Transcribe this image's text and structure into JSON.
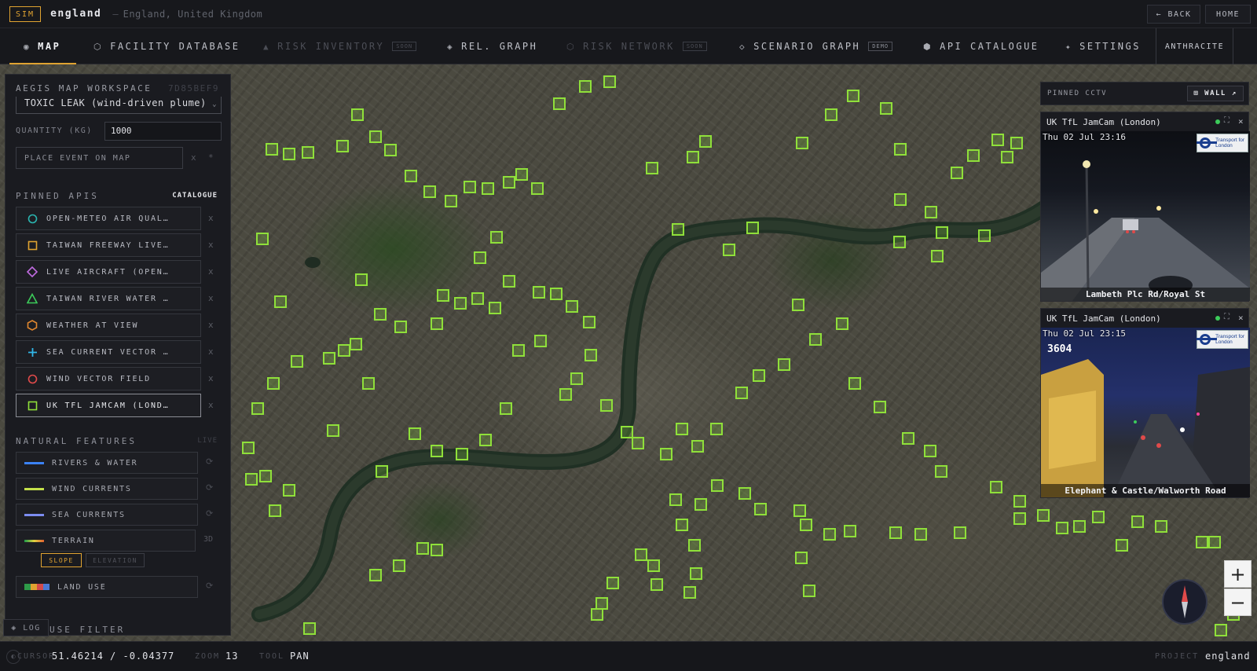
{
  "header": {
    "sim_badge": "SIM",
    "region": "england",
    "separator": "—",
    "region_full": "England, United Kingdom",
    "back_label": "← BACK",
    "home_label": "HOME"
  },
  "nav": {
    "tabs": [
      {
        "icon": "◉",
        "label": "MAP"
      },
      {
        "icon": "⬡",
        "label": "FACILITY DATABASE"
      },
      {
        "icon": "▲",
        "label": "RISK INVENTORY",
        "badge": "SOON"
      },
      {
        "icon": "◈",
        "label": "REL. GRAPH"
      },
      {
        "icon": "⬡",
        "label": "RISK NETWORK",
        "badge": "SOON"
      },
      {
        "icon": "◇",
        "label": "SCENARIO GRAPH",
        "badge": "DEMO"
      },
      {
        "icon": "⬢",
        "label": "API CATALOGUE"
      },
      {
        "icon": "✦",
        "label": "SETTINGS"
      }
    ],
    "theme_label": "ANTHRACITE"
  },
  "panel": {
    "title": "AEGIS MAP WORKSPACE",
    "hash": "7D85BEF9",
    "event_type": "TOXIC LEAK (wind-driven plume)",
    "quantity_label": "QUANTITY (KG)",
    "quantity_value": "1000",
    "place_label": "PLACE EVENT ON MAP",
    "place_clear": "x",
    "place_extra": "*",
    "pinned_apis_label": "PINNED APIS",
    "catalogue_label": "CATALOGUE",
    "apis": [
      {
        "label": "OPEN-METEO AIR QUAL…",
        "icon": "circle-teal"
      },
      {
        "label": "TAIWAN FREEWAY LIVE…",
        "icon": "square-amber"
      },
      {
        "label": "LIVE AIRCRAFT (OPEN…",
        "icon": "diamond-purple"
      },
      {
        "label": "TAIWAN RIVER WATER …",
        "icon": "triangle-green"
      },
      {
        "label": "WEATHER AT VIEW",
        "icon": "hexagon-orange"
      },
      {
        "label": "SEA CURRENT VECTOR …",
        "icon": "plus-cyan"
      },
      {
        "label": "WIND VECTOR FIELD",
        "icon": "circle-red"
      },
      {
        "label": "UK TFL JAMCAM (LOND…",
        "icon": "square-green"
      }
    ],
    "remove_glyph": "x",
    "natural_features_label": "NATURAL FEATURES",
    "live_label": "LIVE",
    "features": [
      {
        "label": "RIVERS & WATER",
        "color": "#3b82f6"
      },
      {
        "label": "WIND CURRENTS",
        "color": "#c4e04a"
      },
      {
        "label": "SEA CURRENTS",
        "color": "#7c8cf0"
      },
      {
        "label": "TERRAIN",
        "mode": "3D"
      },
      {
        "label": "LAND USE"
      }
    ],
    "reload_glyph": "⟳",
    "slope_label": "SLOPE",
    "elevation_label": "ELEVATION",
    "cut_label": "USE FILTER",
    "log_label": "◈ LOG"
  },
  "cctv": {
    "header": "PINNED CCTV",
    "wall_label": "⊞ WALL ↗",
    "cams": [
      {
        "title": "UK TfL JamCam (London)",
        "timestamp": "Thu 02 Jul 23:16",
        "caption": "Lambeth Plc Rd/Royal St"
      },
      {
        "title": "UK TfL JamCam (London)",
        "timestamp": "Thu 02 Jul 23:15",
        "caption": "Elephant & Castle/Walworth Road",
        "overlay": "3604"
      }
    ],
    "tfl_brand": "Transport for London",
    "close_glyph": "×",
    "expand_glyph": "⛶"
  },
  "map_controls": {
    "zoom_in": "+",
    "zoom_out": "−"
  },
  "status": {
    "cursor_label": "CURSOR",
    "cursor_value": "51.46214 / -0.04377",
    "zoom_label": "ZOOM",
    "zoom_value": "13",
    "tool_label": "TOOL",
    "tool_value": "PAN",
    "project_label": "PROJECT",
    "project_value": "england"
  },
  "colors": {
    "accent": "#e0a331",
    "marker": "#8fe03a",
    "live_dot": "#3ccb5a"
  }
}
